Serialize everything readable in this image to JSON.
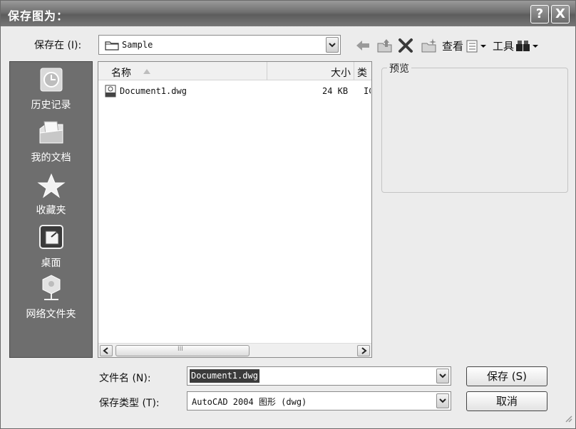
{
  "title": "保存图为：",
  "titlebar_buttons": {
    "help": "?",
    "close": "X"
  },
  "save_in": {
    "label": "保存在 (I):",
    "value": "Sample"
  },
  "toolbar": {
    "view_label": "查看",
    "tools_label": "工具"
  },
  "places": [
    {
      "label": "历史记录",
      "icon": "history-icon"
    },
    {
      "label": "我的文档",
      "icon": "my-documents-icon"
    },
    {
      "label": "收藏夹",
      "icon": "favorites-star-icon"
    },
    {
      "label": "桌面",
      "icon": "desktop-icon"
    },
    {
      "label": "网络文件夹",
      "icon": "network-folder-icon"
    }
  ],
  "file_list": {
    "columns": {
      "name": "名称",
      "size": "大小",
      "type": "类"
    },
    "rows": [
      {
        "name": "Document1.dwg",
        "size": "24 KB",
        "type": "IC"
      }
    ],
    "scroll_grip": "III"
  },
  "preview": {
    "label": "预览"
  },
  "filename": {
    "label": "文件名 (N):",
    "value": "Document1.dwg"
  },
  "filetype": {
    "label": "保存类型 (T):",
    "value": "AutoCAD 2004 图形 (dwg)"
  },
  "buttons": {
    "save": "保存 (S)",
    "cancel": "取消"
  }
}
